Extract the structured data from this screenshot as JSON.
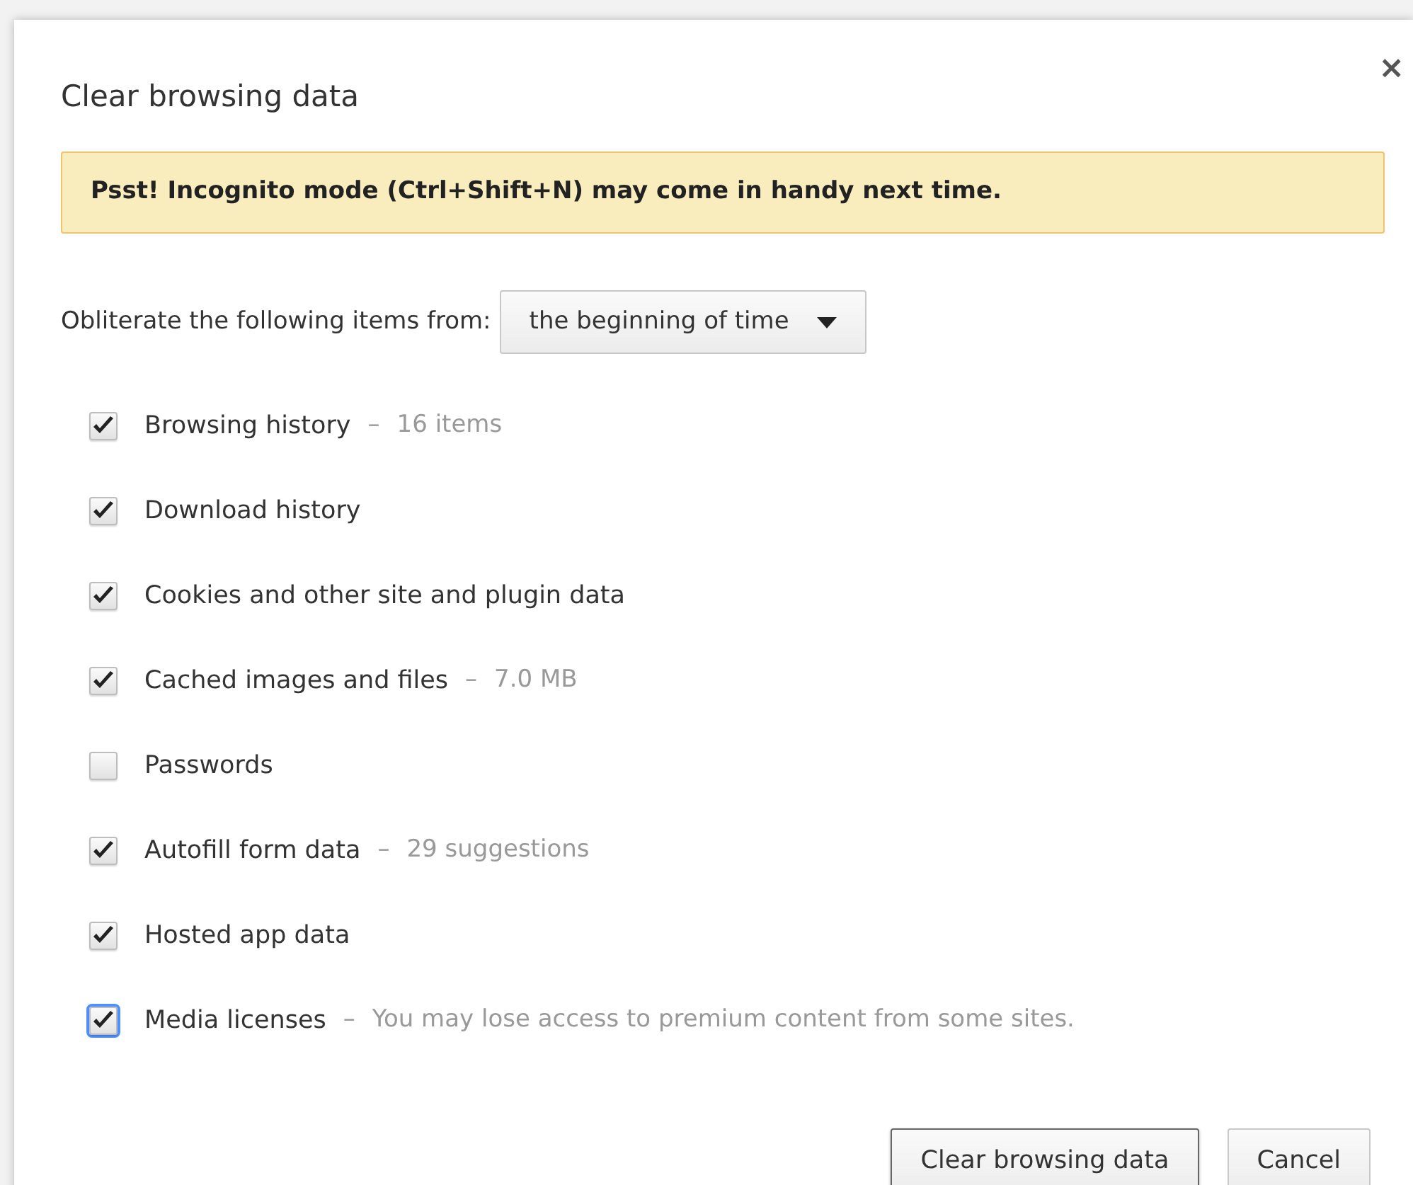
{
  "dialog": {
    "title": "Clear browsing data",
    "close": "×"
  },
  "notice": "Psst! Incognito mode (Ctrl+Shift+N) may come in handy next time.",
  "range": {
    "label": "Obliterate the following items from:",
    "value": "the beginning of time"
  },
  "items": [
    {
      "label": "Browsing history",
      "separator": "–",
      "detail": "16 items",
      "checked": true,
      "focused": false
    },
    {
      "label": "Download history",
      "checked": true,
      "focused": false
    },
    {
      "label": "Cookies and other site and plugin data",
      "checked": true,
      "focused": false
    },
    {
      "label": "Cached images and files",
      "separator": "–",
      "detail": "7.0 MB",
      "checked": true,
      "focused": false
    },
    {
      "label": "Passwords",
      "checked": false,
      "focused": false
    },
    {
      "label": "Autofill form data",
      "separator": "–",
      "detail": "29 suggestions",
      "checked": true,
      "focused": false
    },
    {
      "label": "Hosted app data",
      "checked": true,
      "focused": false
    },
    {
      "label": "Media licenses",
      "separator": "–",
      "detail": "You may lose access to premium content from some sites.",
      "checked": true,
      "focused": true
    }
  ],
  "buttons": [
    {
      "label": "Clear browsing data",
      "kind": "primary"
    },
    {
      "label": "Cancel",
      "kind": "secondary"
    }
  ]
}
